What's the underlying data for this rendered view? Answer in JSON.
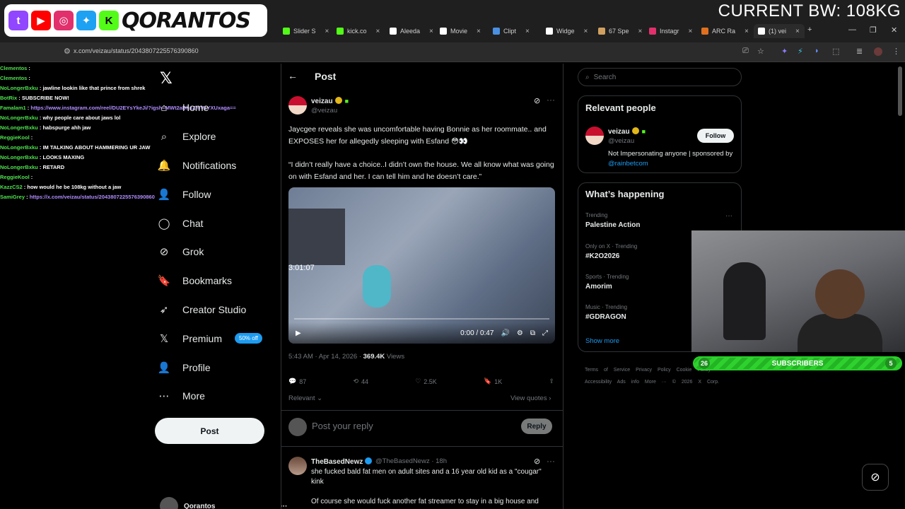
{
  "overlay": {
    "streamer_name": "QORANTOS",
    "bandwidth": "CURRENT BW: 108KG",
    "subscribers_label": "SUBSCRIBERS",
    "subscribers_left": "26",
    "subscribers_right": "5"
  },
  "browser": {
    "tabs": [
      {
        "label": "Slider S",
        "color": "#53fc18",
        "active": false
      },
      {
        "label": "kick.co",
        "color": "#53fc18",
        "active": false
      },
      {
        "label": "Aleeda",
        "color": "#ffffff",
        "active": false
      },
      {
        "label": "Movie",
        "color": "#ffffff",
        "active": false
      },
      {
        "label": "Clipt",
        "color": "#4a90e2",
        "active": false
      },
      {
        "label": "Widge",
        "color": "#ffffff",
        "active": false
      },
      {
        "label": "67 Spe",
        "color": "#d0a060",
        "active": false
      },
      {
        "label": "Instagr",
        "color": "#e1306c",
        "active": false
      },
      {
        "label": "ARC Ra",
        "color": "#e07020",
        "active": false
      },
      {
        "label": "(1) vei",
        "color": "#ffffff",
        "active": true
      }
    ],
    "url": "x.com/veizau/status/2043807225576390860"
  },
  "chat": [
    {
      "user": "Clementos",
      "msg": "",
      "link": ""
    },
    {
      "user": "Clementos",
      "msg": "",
      "link": ""
    },
    {
      "user": "NoLongerBxku",
      "msg": "jawline lookin like that prince from shrek",
      "link": ""
    },
    {
      "user": "BotRix",
      "msg": "SUBSCRIBE NOW!",
      "link": ""
    },
    {
      "user": "Famalam1",
      "msg": "",
      "link": "https://www.instagram.com/reel/DU2EYsYkeJi/?igsh=MWt2aDhxZmV1YXUxaga=="
    },
    {
      "user": "NoLongerBxku",
      "msg": "why people care about jaws lol",
      "link": ""
    },
    {
      "user": "NoLongerBxku",
      "msg": "habspurge ahh jaw",
      "link": ""
    },
    {
      "user": "ReggieKool",
      "msg": "",
      "link": ""
    },
    {
      "user": "NoLongerBxku",
      "msg": "IM TALKING ABOUT HAMMERING UR JAW",
      "link": ""
    },
    {
      "user": "NoLongerBxku",
      "msg": "LOOKS MAXING",
      "link": ""
    },
    {
      "user": "NoLongerBxku",
      "msg": "RETARD",
      "link": ""
    },
    {
      "user": "ReggieKool",
      "msg": "",
      "link": ""
    },
    {
      "user": "KazzCS2",
      "msg": "how would he be 108kg without a jaw",
      "link": ""
    },
    {
      "user": "SamiGrey",
      "msg": "",
      "link": "https://x.com/veizau/status/2043807225576390860"
    }
  ],
  "nav": {
    "items": [
      {
        "label": "Home",
        "icon": "home-icon",
        "glyph": "⌂"
      },
      {
        "label": "Explore",
        "icon": "search-icon",
        "glyph": "⌕"
      },
      {
        "label": "Notifications",
        "icon": "bell-icon",
        "glyph": "🔔"
      },
      {
        "label": "Follow",
        "icon": "person-plus-icon",
        "glyph": "👤"
      },
      {
        "label": "Chat",
        "icon": "chat-icon",
        "glyph": "◯"
      },
      {
        "label": "Grok",
        "icon": "grok-icon",
        "glyph": "⊘"
      },
      {
        "label": "Bookmarks",
        "icon": "bookmark-icon",
        "glyph": "🔖"
      },
      {
        "label": "Creator Studio",
        "icon": "rocket-icon",
        "glyph": "➶"
      },
      {
        "label": "Premium",
        "icon": "x-icon",
        "glyph": "𝕏"
      },
      {
        "label": "Profile",
        "icon": "profile-icon",
        "glyph": "👤"
      },
      {
        "label": "More",
        "icon": "more-icon",
        "glyph": "⋯"
      }
    ],
    "premium_badge": "50% off",
    "post_button": "Post",
    "account_name": "Qorantos"
  },
  "post": {
    "header": "Post",
    "author_name": "veizau",
    "author_handle": "@veizau",
    "text_1": "Jaycgee reveals she was uncomfortable having Bonnie as her roommate.. and EXPOSES her for allegedly sleeping with Esfand 😳👀",
    "text_2": "“I didn’t really have a choice..I didn’t own the house. We all know what was going on with Esfand and her. I can tell him and he doesn’t care.”",
    "video_timestamp_overlay": "3:01:07",
    "video_time": "0:00 / 0:47",
    "time": "5:43 AM · Apr 14, 2026 · ",
    "views_count": "369.4K",
    "views_label": " Views",
    "replies": "87",
    "reposts": "44",
    "likes": "2.5K",
    "bookmarks": "1K",
    "sort_label": "Relevant",
    "view_quotes": "View quotes",
    "reply_placeholder": "Post your reply",
    "reply_button": "Reply"
  },
  "reply_tweet": {
    "name": "TheBasedNewz",
    "meta": "@TheBasedNewz · 18h",
    "text_1": "she fucked bald fat men on adult sites and a 16 year old kid as a \"cougar\" kink",
    "text_2": "Of course she would fuck another fat streamer to stay in a big house and"
  },
  "sidebar": {
    "search_placeholder": "Search",
    "relevant_title": "Relevant people",
    "person_name": "veizau",
    "person_handle": "@veizau",
    "follow_label": "Follow",
    "bio": "Not Impersonating anyone | sponsored by ",
    "bio_link": "@rainbetcom",
    "happening_title": "What’s happening",
    "trends": [
      {
        "context": "Trending",
        "name": "Palestine Action"
      },
      {
        "context": "Only on X · Trending",
        "name": "#K2O2026"
      },
      {
        "context": "Sports · Trending",
        "name": "Amorim"
      },
      {
        "context": "Music · Trending",
        "name": "#GDRAGON"
      }
    ],
    "show_more": "Show more",
    "footer": "Terms of Service  Privacy Policy  Cookie Policy  Accessibility  Ads info  More ···  © 2026 X Corp."
  }
}
